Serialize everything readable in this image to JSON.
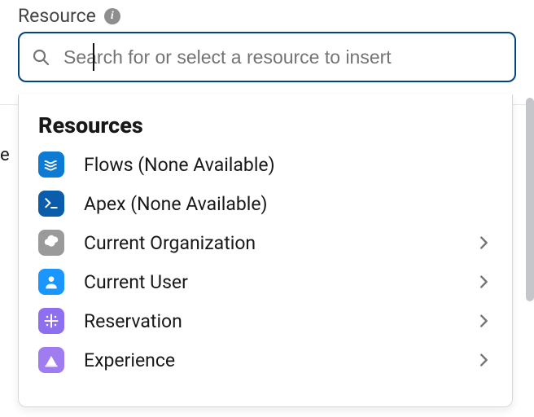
{
  "field": {
    "label": "Resource",
    "info_tooltip": "i"
  },
  "search": {
    "placeholder": "Search for or select a resource to insert",
    "value": ""
  },
  "dropdown": {
    "heading": "Resources",
    "options": [
      {
        "label": "Flows (None Available)",
        "icon": "flow-icon",
        "icon_class": "icon-blue",
        "has_children": false
      },
      {
        "label": "Apex (None Available)",
        "icon": "apex-icon",
        "icon_class": "icon-darkblue",
        "has_children": false
      },
      {
        "label": "Current Organization",
        "icon": "org-icon",
        "icon_class": "icon-gray",
        "has_children": true
      },
      {
        "label": "Current User",
        "icon": "user-icon",
        "icon_class": "icon-blue2",
        "has_children": true
      },
      {
        "label": "Reservation",
        "icon": "reservation-icon",
        "icon_class": "icon-purple",
        "has_children": true
      },
      {
        "label": "Experience",
        "icon": "experience-icon",
        "icon_class": "icon-purple2",
        "has_children": true
      }
    ]
  },
  "background": {
    "snippet": "e"
  }
}
